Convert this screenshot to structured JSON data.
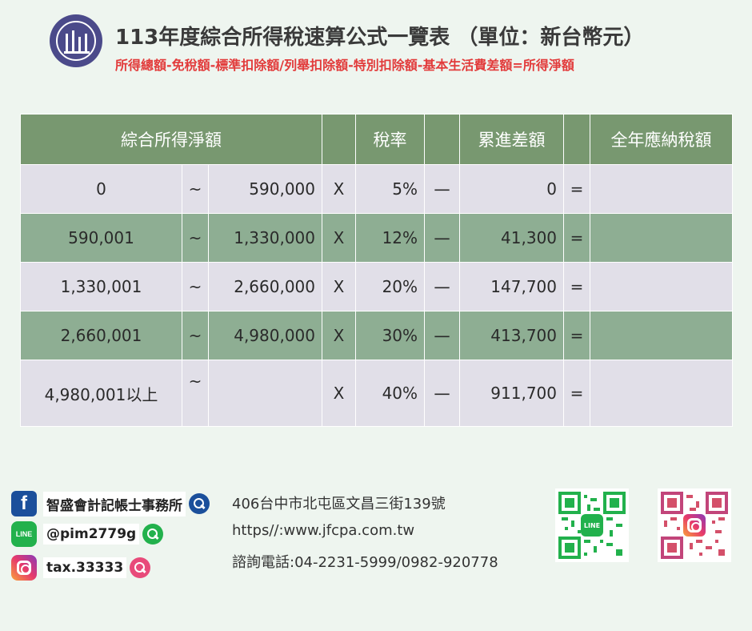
{
  "header": {
    "title": "113年度綜合所得稅速算公式一覽表 （單位：新台幣元）",
    "subtitle": "所得總額-免稅額-標準扣除額/列舉扣除額-特別扣除額-基本生活費差額=所得淨額",
    "logo_icon": "office-logo-icon"
  },
  "table": {
    "headers": {
      "net_income": "綜合所得淨額",
      "rate": "稅率",
      "progressive_difference": "累進差額",
      "annual_tax": "全年應納稅額"
    },
    "rows": [
      {
        "from": "0",
        "tilde": "~",
        "to": "590,000",
        "x": "X",
        "rate": "5%",
        "minus": "一",
        "diff": "0",
        "eq": "="
      },
      {
        "from": "590,001",
        "tilde": "~",
        "to": "1,330,000",
        "x": "X",
        "rate": "12%",
        "minus": "一",
        "diff": "41,300",
        "eq": "="
      },
      {
        "from": "1,330,001",
        "tilde": "~",
        "to": "2,660,000",
        "x": "X",
        "rate": "20%",
        "minus": "一",
        "diff": "147,700",
        "eq": "="
      },
      {
        "from": "2,660,001",
        "tilde": "~",
        "to": "4,980,000",
        "x": "X",
        "rate": "30%",
        "minus": "一",
        "diff": "413,700",
        "eq": "="
      },
      {
        "from": "4,980,001以上",
        "tilde": "~",
        "to": "",
        "x": "X",
        "rate": "40%",
        "minus": "一",
        "diff": "911,700",
        "eq": "="
      }
    ]
  },
  "footer": {
    "facebook_label": "智盛會計記帳士事務所",
    "line_label": "@pim2779g",
    "line_icon_text": "LINE",
    "instagram_label": "tax.33333",
    "address": "406台中市北屯區文昌三街139號",
    "website": "https//:www.jfcpa.com.tw",
    "phone": "諮詢電話:04-2231-5999/0982-920778",
    "qr_line_text": "LINE"
  },
  "colors": {
    "header_row": "#789870",
    "row_light": "#e1dfe8",
    "row_green": "#8eae93",
    "subtitle_red": "#e23b3b",
    "background": "#eef5ef"
  }
}
